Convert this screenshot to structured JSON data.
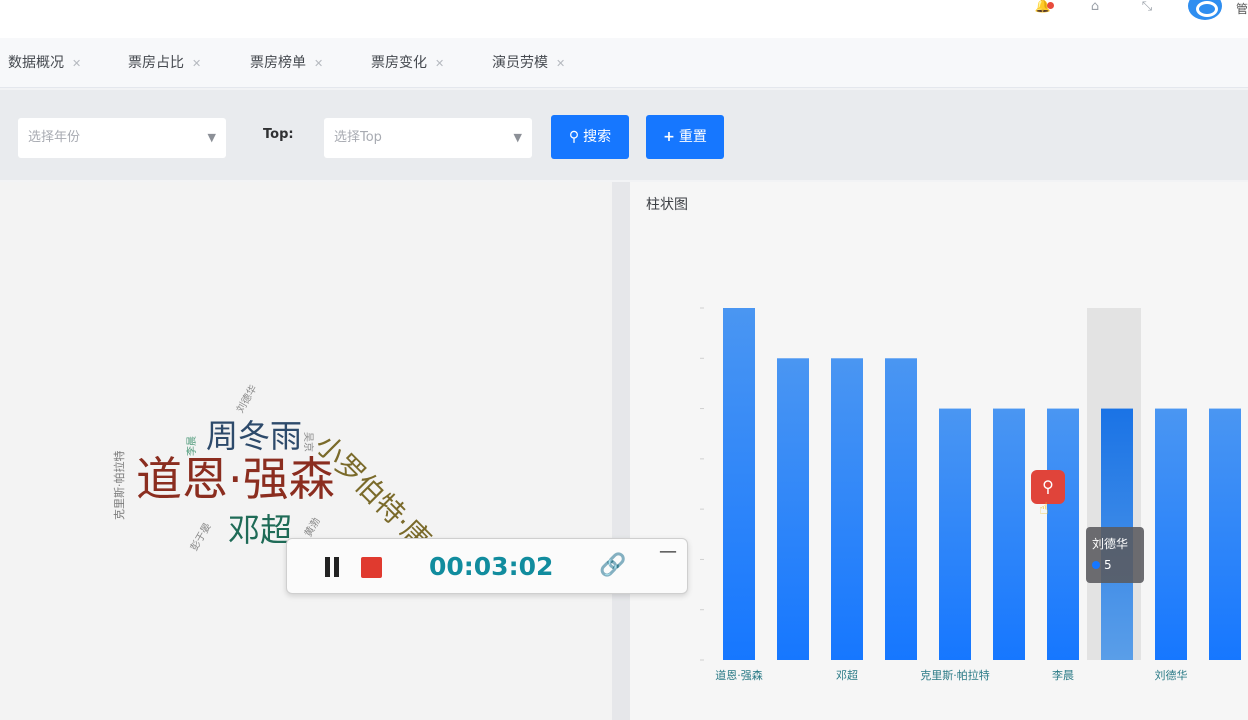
{
  "header": {
    "icons": [
      "bell-icon",
      "tag-icon",
      "expand-icon"
    ],
    "avatar_text": "管"
  },
  "tabs": [
    {
      "label": "数据概况"
    },
    {
      "label": "票房占比"
    },
    {
      "label": "票房榜单"
    },
    {
      "label": "票房变化"
    },
    {
      "label": "演员劳模"
    }
  ],
  "filters": {
    "year_placeholder": "选择年份",
    "top_label": "Top:",
    "top_placeholder": "选择Top",
    "search_label": "搜索",
    "reset_label": "重置"
  },
  "chart_panel": {
    "title": "柱状图"
  },
  "wordcloud": {
    "words": [
      {
        "text": "道恩·强森",
        "color": "#8b2d1f"
      },
      {
        "text": "小罗伯特·唐尼",
        "color": "#7a6a2a"
      },
      {
        "text": "周冬雨",
        "color": "#2d4a6b"
      },
      {
        "text": "邓超",
        "color": "#1f6b57"
      },
      {
        "text": "刘德华",
        "color": "#8a8a8a"
      },
      {
        "text": "克里斯·帕拉特",
        "color": "#7a7a7a"
      },
      {
        "text": "李晨",
        "color": "#4e9a7a"
      },
      {
        "text": "吴京",
        "color": "#888888"
      },
      {
        "text": "黄渤",
        "color": "#888888"
      },
      {
        "text": "彭于晏",
        "color": "#888888"
      }
    ]
  },
  "chart_data": {
    "type": "bar",
    "title": "",
    "categories": [
      "道恩·强森",
      "",
      "邓超",
      "",
      "克里斯·帕拉特",
      "",
      "李晨",
      "",
      "刘德华",
      ""
    ],
    "values": [
      7,
      6,
      6,
      6,
      5,
      5,
      5,
      5,
      5,
      5
    ],
    "ylim": [
      0,
      7
    ],
    "highlight_index": 7,
    "bar_color": "#1677ff"
  },
  "tooltip": {
    "name": "刘德华",
    "value": "5"
  },
  "recorder": {
    "time": "00:03:02"
  }
}
